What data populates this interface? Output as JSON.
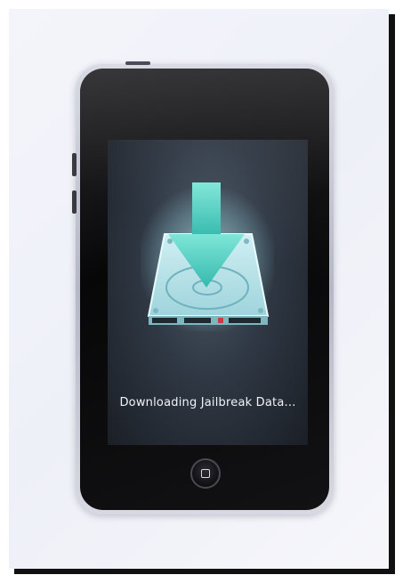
{
  "screen": {
    "caption": "Downloading Jailbreak Data...",
    "icon": "hard-drive-download-icon"
  },
  "device": {
    "home_button_icon": "home-square-icon"
  },
  "colors": {
    "arrow": "#4fcfbf",
    "screen_bg": "#2f3844",
    "caption": "#f2f4f7"
  }
}
